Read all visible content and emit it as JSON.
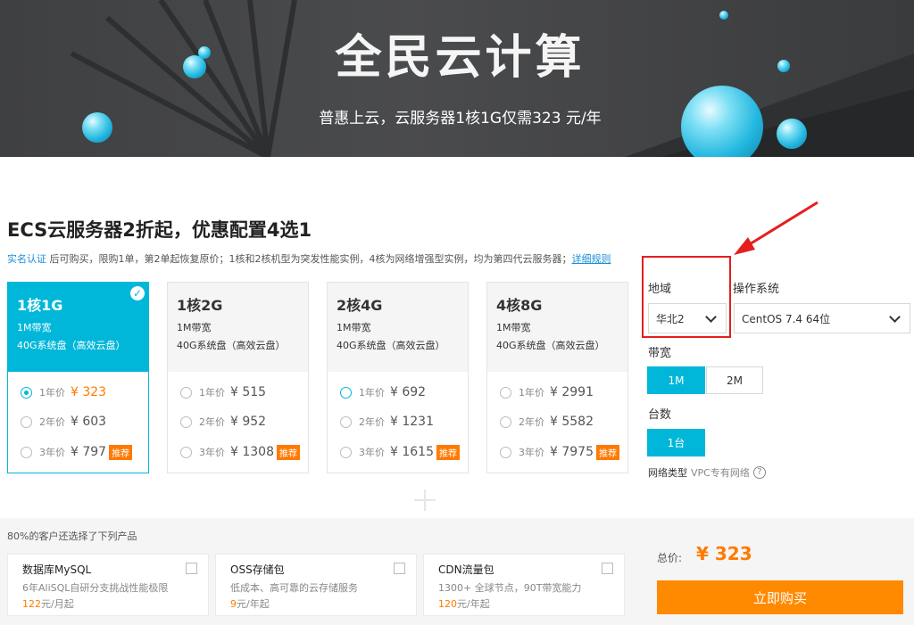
{
  "banner": {
    "title": "全民云计算",
    "subtitle": "普惠上云，云服务器1核1G仅需323 元/年"
  },
  "promo": {
    "heading": "ECS云服务器2折起，优惠配置4选1",
    "notice_link": "实名认证",
    "notice_text": " 后可购买，限购1单，第2单起恢复原价；1核和2核机型为突发性能实例，4核为网络增强型实例，均为第四代云服务器；",
    "rules_link": "详细规则"
  },
  "cards": [
    {
      "spec": "1核1G",
      "bandwidth": "1M带宽",
      "disk": "40G系统盘（高效云盘）",
      "selected": true,
      "options": [
        {
          "label": "1年价",
          "price": "¥ 323",
          "tag": ""
        },
        {
          "label": "2年价",
          "price": "¥ 603",
          "tag": ""
        },
        {
          "label": "3年价",
          "price": "¥ 797",
          "tag": "推荐"
        }
      ]
    },
    {
      "spec": "1核2G",
      "bandwidth": "1M带宽",
      "disk": "40G系统盘（高效云盘）",
      "selected": false,
      "options": [
        {
          "label": "1年价",
          "price": "¥ 515",
          "tag": ""
        },
        {
          "label": "2年价",
          "price": "¥ 952",
          "tag": ""
        },
        {
          "label": "3年价",
          "price": "¥ 1308",
          "tag": "推荐"
        }
      ]
    },
    {
      "spec": "2核4G",
      "bandwidth": "1M带宽",
      "disk": "40G系统盘（高效云盘）",
      "selected": false,
      "options": [
        {
          "label": "1年价",
          "price": "¥ 692",
          "tag": ""
        },
        {
          "label": "2年价",
          "price": "¥ 1231",
          "tag": ""
        },
        {
          "label": "3年价",
          "price": "¥ 1615",
          "tag": "推荐"
        }
      ]
    },
    {
      "spec": "4核8G",
      "bandwidth": "1M带宽",
      "disk": "40G系统盘（高效云盘）",
      "selected": false,
      "options": [
        {
          "label": "1年价",
          "price": "¥ 2991",
          "tag": ""
        },
        {
          "label": "2年价",
          "price": "¥ 5582",
          "tag": ""
        },
        {
          "label": "3年价",
          "price": "¥ 7975",
          "tag": "推荐"
        }
      ]
    }
  ],
  "config": {
    "region_label": "地域",
    "region_value": "华北2",
    "os_label": "操作系统",
    "os_value": "CentOS 7.4 64位",
    "bandwidth_label": "带宽",
    "bandwidth_options": [
      "1M",
      "2M"
    ],
    "quantity_label": "台数",
    "quantity_value": "1台",
    "network_label": "网络类型",
    "network_value": "VPC专有网络",
    "help_icon": "?"
  },
  "footer": {
    "title": "80%的客户还选择了下列产品",
    "products": [
      {
        "name": "数据库MySQL",
        "desc": "6年AliSQL自研分支挑战性能极限",
        "price": "122",
        "unit": "元/月起"
      },
      {
        "name": "OSS存储包",
        "desc": "低成本、高可靠的云存储服务",
        "price": "9",
        "unit": "元/年起"
      },
      {
        "name": "CDN流量包",
        "desc": "1300+ 全球节点，90T带宽能力",
        "price": "120",
        "unit": "元/年起"
      }
    ],
    "total_label": "总价:",
    "total_value": "¥ 323",
    "buy_label": "立即购买"
  },
  "colors": {
    "accent": "#00b7d9",
    "orange": "#ff8a00",
    "annotation": "#e61e1e"
  }
}
